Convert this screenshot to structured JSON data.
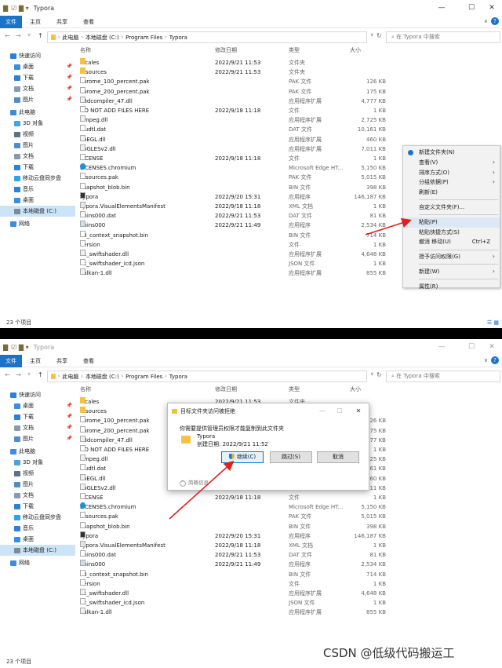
{
  "window": {
    "title": "Typora",
    "minimize": "—",
    "maximize": "☐",
    "close": "✕"
  },
  "ribbon": {
    "file": "文件",
    "tabs": [
      "主页",
      "共享",
      "查看"
    ],
    "expand": "∨",
    "help": "?"
  },
  "address": {
    "path": [
      "此电脑",
      "本地磁盘 (C:)",
      "Program Files",
      "Typora"
    ],
    "search_placeholder": "在 Typora 中搜索"
  },
  "nav": [
    {
      "label": "快速访问",
      "color": "#2b80d8",
      "pin": false,
      "indent": 0
    },
    {
      "label": "桌面",
      "color": "#3b8ede",
      "pin": true,
      "indent": 1
    },
    {
      "label": "下载",
      "color": "#2b80d8",
      "pin": true,
      "indent": 1
    },
    {
      "label": "文档",
      "color": "#8a9bb0",
      "pin": true,
      "indent": 1
    },
    {
      "label": "图片",
      "color": "#4f8fc6",
      "pin": true,
      "indent": 1
    },
    {
      "label": "此电脑",
      "color": "#3b8ede",
      "pin": false,
      "indent": 0
    },
    {
      "label": "3D 对象",
      "color": "#47a3e0",
      "pin": false,
      "indent": 1
    },
    {
      "label": "视频",
      "color": "#5d6f8a",
      "pin": false,
      "indent": 1
    },
    {
      "label": "图片",
      "color": "#4f8fc6",
      "pin": false,
      "indent": 1
    },
    {
      "label": "文档",
      "color": "#8a9bb0",
      "pin": false,
      "indent": 1
    },
    {
      "label": "下载",
      "color": "#2b80d8",
      "pin": false,
      "indent": 1
    },
    {
      "label": "移动云盘同步盘",
      "color": "#2aa6e8",
      "pin": false,
      "indent": 1
    },
    {
      "label": "音乐",
      "color": "#2b80d8",
      "pin": false,
      "indent": 1
    },
    {
      "label": "桌面",
      "color": "#3b8ede",
      "pin": false,
      "indent": 1
    },
    {
      "label": "本地磁盘 (C:)",
      "color": "#7a8a99",
      "pin": false,
      "indent": 1,
      "selected": true
    },
    {
      "label": "网络",
      "color": "#3b8ede",
      "pin": false,
      "indent": 0
    }
  ],
  "pin_glyph": "📌",
  "columns": [
    "名称",
    "修改日期",
    "类型",
    "大小"
  ],
  "files": [
    {
      "name": "locales",
      "date": "2022/9/21 11:53",
      "type": "文件夹",
      "size": "",
      "icon": "folder"
    },
    {
      "name": "resources",
      "date": "2022/9/21 11:53",
      "type": "文件夹",
      "size": "",
      "icon": "folder"
    },
    {
      "name": "chrome_100_percent.pak",
      "date": "",
      "type": "PAK 文件",
      "size": "126 KB",
      "icon": "file"
    },
    {
      "name": "chrome_200_percent.pak",
      "date": "",
      "type": "PAK 文件",
      "size": "175 KB",
      "icon": "file"
    },
    {
      "name": "d3dcompiler_47.dll",
      "date": "",
      "type": "应用程序扩展",
      "size": "4,777 KB",
      "icon": "dll"
    },
    {
      "name": "DO NOT ADD FILES HERE",
      "date": "2022/9/18 11:18",
      "type": "文件",
      "size": "1 KB",
      "icon": "file"
    },
    {
      "name": "ffmpeg.dll",
      "date": "",
      "type": "应用程序扩展",
      "size": "2,725 KB",
      "icon": "dll"
    },
    {
      "name": "icudtl.dat",
      "date": "",
      "type": "DAT 文件",
      "size": "10,161 KB",
      "icon": "file"
    },
    {
      "name": "libEGL.dll",
      "date": "",
      "type": "应用程序扩展",
      "size": "460 KB",
      "icon": "dll"
    },
    {
      "name": "libGLESv2.dll",
      "date": "",
      "type": "应用程序扩展",
      "size": "7,011 KB",
      "icon": "dll"
    },
    {
      "name": "LICENSE",
      "date": "2022/9/18 11:18",
      "type": "文件",
      "size": "1 KB",
      "icon": "file"
    },
    {
      "name": "LICENSES.chromium",
      "date": "",
      "type": "Microsoft Edge HT...",
      "size": "5,150 KB",
      "icon": "edge"
    },
    {
      "name": "resources.pak",
      "date": "",
      "type": "PAK 文件",
      "size": "5,015 KB",
      "icon": "file"
    },
    {
      "name": "snapshot_blob.bin",
      "date": "",
      "type": "BIN 文件",
      "size": "398 KB",
      "icon": "file"
    },
    {
      "name": "Typora",
      "date": "2022/9/20 15:31",
      "type": "应用程序",
      "size": "146,187 KB",
      "icon": "app"
    },
    {
      "name": "Typora.VisualElementsManifest",
      "date": "2022/9/18 11:18",
      "type": "XML 文档",
      "size": "1 KB",
      "icon": "xml"
    },
    {
      "name": "unins000.dat",
      "date": "2022/9/21 11:53",
      "type": "DAT 文件",
      "size": "81 KB",
      "icon": "file"
    },
    {
      "name": "unins000",
      "date": "2022/9/21 11:49",
      "type": "应用程序",
      "size": "2,534 KB",
      "icon": "app2"
    },
    {
      "name": "v8_context_snapshot.bin",
      "date": "",
      "type": "BIN 文件",
      "size": "714 KB",
      "icon": "file"
    },
    {
      "name": "version",
      "date": "",
      "type": "文件",
      "size": "1 KB",
      "icon": "file"
    },
    {
      "name": "vk_swiftshader.dll",
      "date": "",
      "type": "应用程序扩展",
      "size": "4,648 KB",
      "icon": "dll"
    },
    {
      "name": "vk_swiftshader_icd.json",
      "date": "",
      "type": "JSON 文件",
      "size": "1 KB",
      "icon": "file"
    },
    {
      "name": "vulkan-1.dll",
      "date": "",
      "type": "应用程序扩展",
      "size": "855 KB",
      "icon": "dll"
    }
  ],
  "status": "23 个项目",
  "view_icons": "☰ ▦",
  "context_menu": {
    "items": [
      {
        "label": "新建文件夹(N)",
        "icon": true
      },
      {
        "label": "查看(V)",
        "arrow": true
      },
      {
        "label": "排序方式(O)",
        "arrow": true
      },
      {
        "label": "分组依据(P)",
        "arrow": true
      },
      {
        "label": "刷新(E)"
      },
      {
        "divider": true
      },
      {
        "label": "自定义文件夹(F)..."
      },
      {
        "divider": true
      },
      {
        "label": "粘贴(P)",
        "highlight": true
      },
      {
        "label": "粘贴快捷方式(S)"
      },
      {
        "label": "撤消 移动(U)",
        "shortcut": "Ctrl+Z"
      },
      {
        "divider": true
      },
      {
        "label": "授予访问权限(G)",
        "arrow": true
      },
      {
        "divider": true
      },
      {
        "label": "新建(W)",
        "arrow": true
      },
      {
        "divider": true
      },
      {
        "label": "属性(R)"
      }
    ]
  },
  "dialog": {
    "title": "目标文件夹访问被拒绝",
    "message": "你需要提供管理员权限才能复制到此文件夹",
    "folder_name": "Typora",
    "created": "创建日期: 2022/9/21 11:52",
    "continue": "继续(C)",
    "skip": "跳过(S)",
    "cancel": "取消",
    "more": "简略信息",
    "min": "—",
    "max": "☐",
    "close": "✕"
  },
  "watermark": "CSDN @低级代码搬运工",
  "colors": {
    "accent": "#1a73c8",
    "selection": "#cce4f7",
    "arrow": "#e02020",
    "folder": "#f5c242"
  }
}
